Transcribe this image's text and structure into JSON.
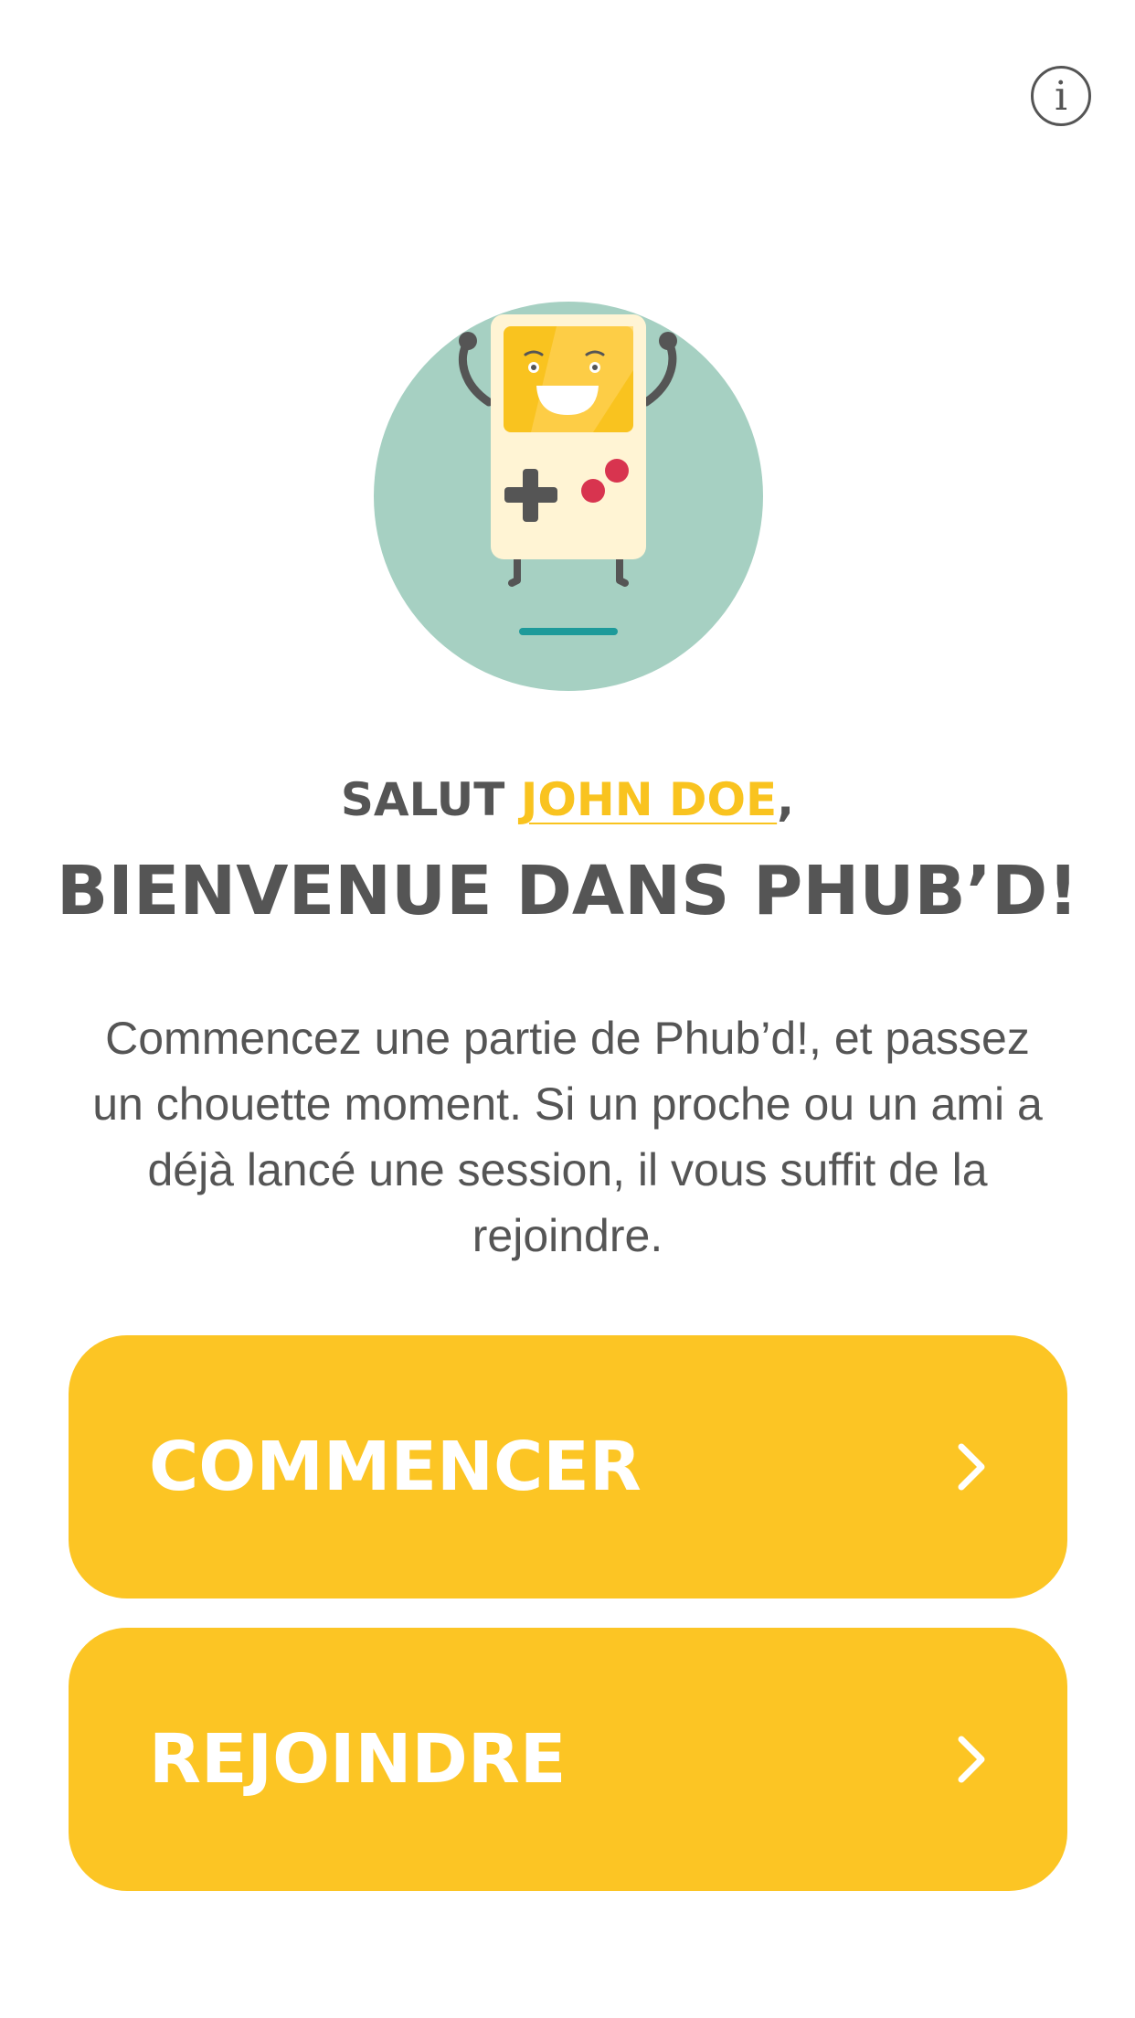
{
  "header": {
    "info_icon": "info-circle-icon",
    "info_glyph": "i"
  },
  "hero": {
    "illustration": "jumping-game-console-mascot",
    "colors": {
      "circle": "#A6D0C2",
      "body": "#FFF4D4",
      "screen": "#F9C31F",
      "accent": "#D8344F",
      "shadow": "#1D9A9A",
      "ink": "#555555"
    }
  },
  "greeting": {
    "prefix": "SALUT ",
    "name": "JOHN DOE",
    "suffix": ","
  },
  "welcome": {
    "title": "BIENVENUE DANS PHUB’D!"
  },
  "intro": {
    "text": "Commencez une partie de Phub’d!, et passez un chouette moment. Si un proche ou un ami a déjà lancé une session, il vous suffit de la rejoindre."
  },
  "actions": {
    "start_label": "COMMENCER",
    "join_label": "REJOINDRE",
    "chevron_icon": "chevron-right-icon",
    "button_color": "#FCC524"
  },
  "theme": {
    "text": "#555555",
    "accent": "#F9C31F",
    "background": "#FFFFFF"
  }
}
